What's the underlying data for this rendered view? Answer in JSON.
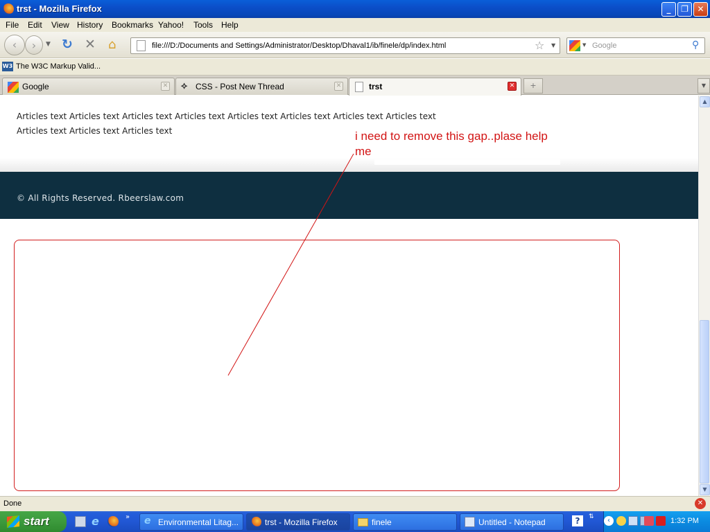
{
  "window": {
    "title": "trst - Mozilla Firefox",
    "controls": [
      "minimize",
      "restore",
      "close"
    ]
  },
  "menu": {
    "items": [
      "File",
      "Edit",
      "View",
      "History",
      "Bookmarks",
      "Yahoo!",
      "Tools",
      "Help"
    ]
  },
  "navigation": {
    "url": "file:///D:/Documents and Settings/Administrator/Desktop/Dhaval1/ib/finele/dp/index.html",
    "search_placeholder": "Google"
  },
  "bookmarks": {
    "items": [
      "The W3C Markup Valid..."
    ]
  },
  "tabs": [
    {
      "label": "Google",
      "active": false
    },
    {
      "label": "CSS - Post New Thread",
      "active": false
    },
    {
      "label": "trst",
      "active": true
    }
  ],
  "page": {
    "article_text": "Articles text Articles text Articles text Articles text Articles text Articles text Articles text Articles text Articles text Articles text Articles text",
    "footer_text": "© All Rights Reserved. Rbeerslaw.com",
    "annotation": "i need to remove this gap..plase help me",
    "colors": {
      "footer_bg": "#0e2f40",
      "annotation": "#d21414",
      "highlight_box": "#d21c1c"
    }
  },
  "status": {
    "text": "Done"
  },
  "taskbar": {
    "start_label": "start",
    "tasks": [
      {
        "label": "Environmental Litag...",
        "active": false
      },
      {
        "label": "trst - Mozilla Firefox",
        "active": true
      },
      {
        "label": "finele",
        "active": false
      },
      {
        "label": "Untitled - Notepad",
        "active": false
      }
    ],
    "clock": "1:32 PM"
  }
}
